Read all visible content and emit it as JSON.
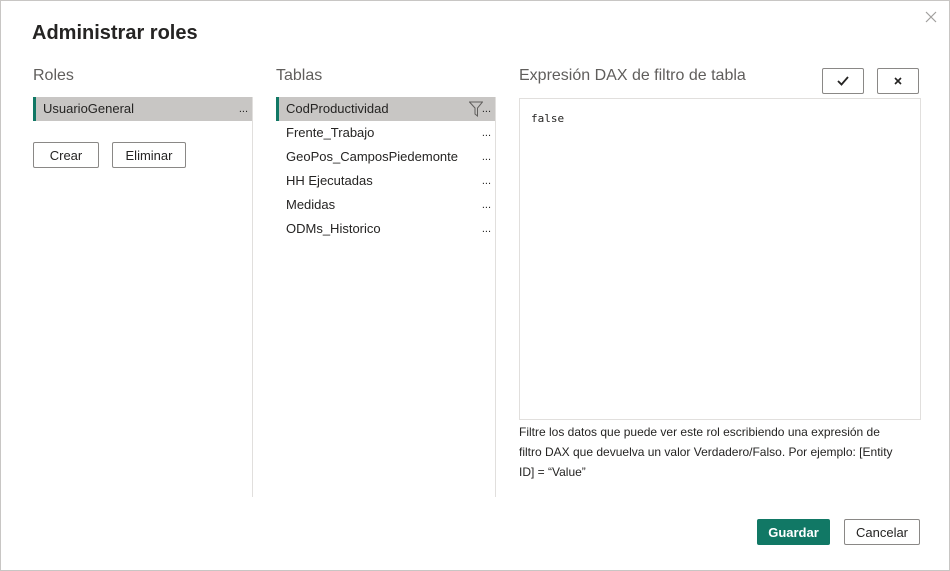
{
  "dialog": {
    "title": "Administrar roles",
    "close_icon": "close-icon"
  },
  "roles": {
    "header": "Roles",
    "items": [
      {
        "label": "UsuarioGeneral",
        "more": "..."
      }
    ],
    "create_label": "Crear",
    "delete_label": "Eliminar"
  },
  "tables": {
    "header": "Tablas",
    "items": [
      {
        "label": "CodProductividad",
        "more": "...",
        "selected": true,
        "icon": "filter-icon"
      },
      {
        "label": "Frente_Trabajo",
        "more": "..."
      },
      {
        "label": "GeoPos_CamposPiedemonte",
        "more": "..."
      },
      {
        "label": "HH Ejecutadas",
        "more": "..."
      },
      {
        "label": "Medidas",
        "more": "..."
      },
      {
        "label": "ODMs_Historico",
        "more": "..."
      }
    ]
  },
  "dax": {
    "header": "Expresión DAX de filtro de tabla",
    "confirm_icon": "checkmark-icon",
    "cancel_icon": "x-icon",
    "expression": "false",
    "help_text": "Filtre los datos que puede ver este rol escribiendo una expresión de filtro DAX que devuelva un valor Verdadero/Falso. Por ejemplo: [Entity ID] = “Value”"
  },
  "footer": {
    "save_label": "Guardar",
    "cancel_label": "Cancelar"
  },
  "colors": {
    "accent": "#117865",
    "selected_bg": "#c8c6c4"
  }
}
